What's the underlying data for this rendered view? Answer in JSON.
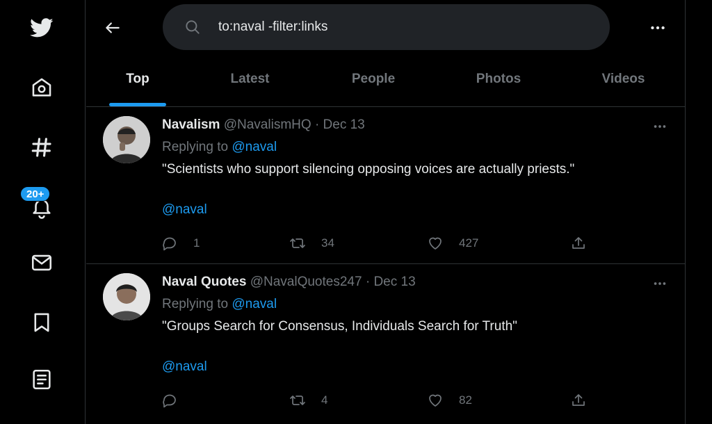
{
  "search": {
    "query": "to:naval -filter:links"
  },
  "nav": {
    "notifications_badge": "20+"
  },
  "tabs": [
    "Top",
    "Latest",
    "People",
    "Photos",
    "Videos"
  ],
  "tweets": [
    {
      "name": "Navalism",
      "handle": "@NavalismHQ",
      "date": "Dec 13",
      "replying_prefix": "Replying to ",
      "replying_to": "@naval",
      "text": "\"Scientists who support silencing opposing voices are actually priests.\"",
      "mention": "@naval",
      "replies": "1",
      "retweets": "34",
      "likes": "427"
    },
    {
      "name": "Naval Quotes",
      "handle": "@NavalQuotes247",
      "date": "Dec 13",
      "replying_prefix": "Replying to ",
      "replying_to": "@naval",
      "text": "\"Groups Search for Consensus, Individuals Search for Truth\"",
      "mention": "@naval",
      "replies": "",
      "retweets": "4",
      "likes": "82"
    }
  ],
  "colors": {
    "accent": "#1d9bf0",
    "muted": "#71767b",
    "background": "#000000",
    "search_bg": "#202327"
  }
}
